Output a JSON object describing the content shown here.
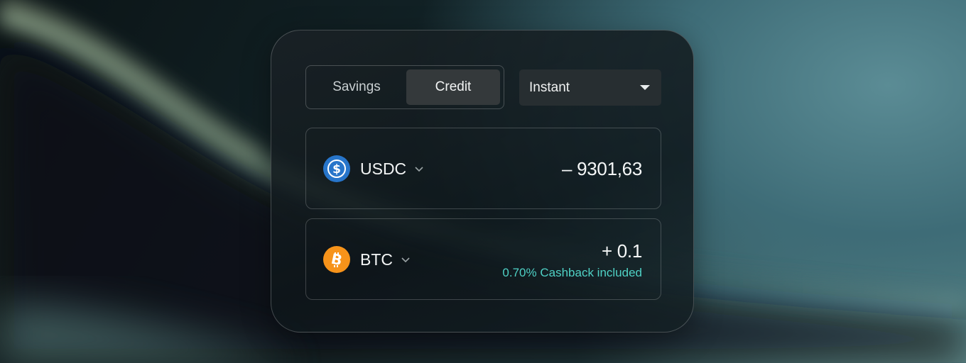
{
  "tabs": {
    "savings_label": "Savings",
    "credit_label": "Credit",
    "selected": "Credit"
  },
  "mode_dropdown": {
    "selected": "Instant",
    "icon": "caret-down-icon"
  },
  "rows": [
    {
      "token": "USDC",
      "icon": "usdc-icon",
      "amount": "– 9301,63",
      "accent_color": "#2775ca"
    },
    {
      "token": "BTC",
      "icon": "bitcoin-icon",
      "amount": "+ 0.1",
      "note": "0.70% Cashback included",
      "accent_color": "#f7931a",
      "note_color": "#4fd1c5"
    }
  ]
}
